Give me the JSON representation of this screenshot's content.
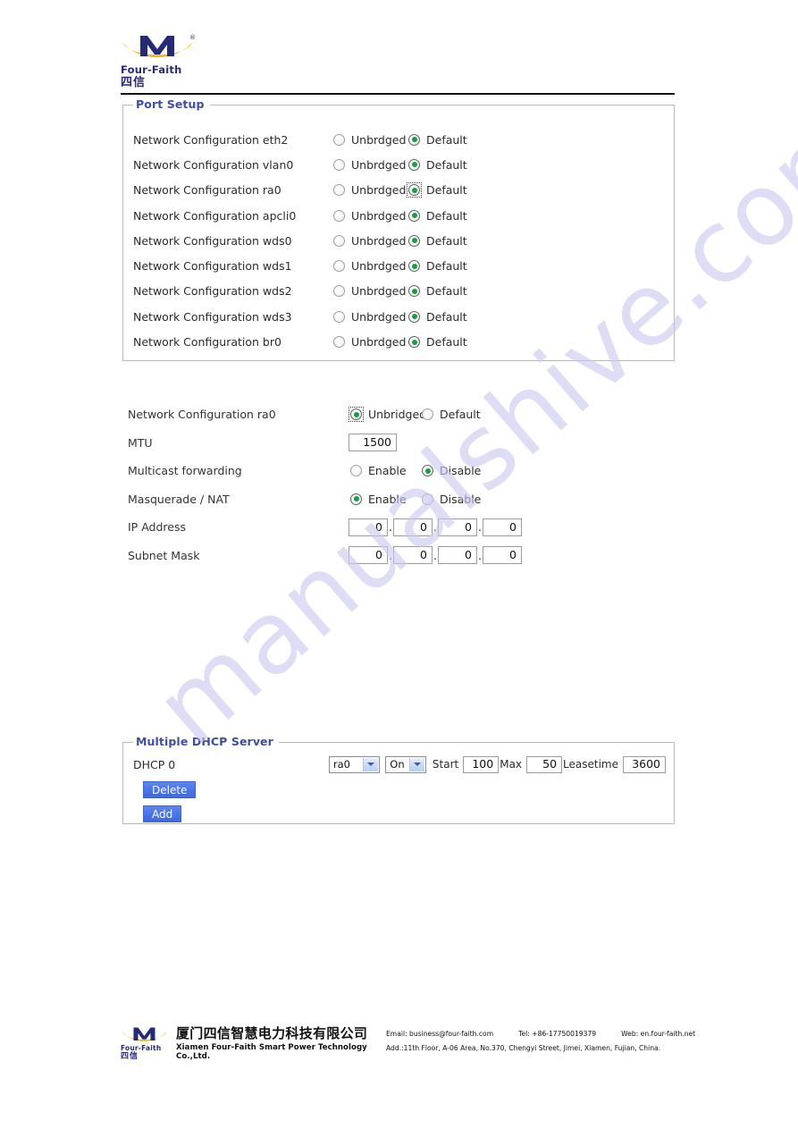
{
  "brand": {
    "name": "Four-Faith",
    "name_cn": "四信",
    "registered_mark": "®"
  },
  "port_setup": {
    "legend": "Port Setup",
    "option_unbridged": "Unbrdged",
    "option_default": "Default",
    "rows": [
      {
        "label": "Network Configuration eth2",
        "selected": "default",
        "focused": false
      },
      {
        "label": "Network Configuration vlan0",
        "selected": "default",
        "focused": false
      },
      {
        "label": "Network Configuration ra0",
        "selected": "default",
        "focused": true
      },
      {
        "label": "Network Configuration apcli0",
        "selected": "default",
        "focused": false
      },
      {
        "label": "Network Configuration wds0",
        "selected": "default",
        "focused": false
      },
      {
        "label": "Network Configuration wds1",
        "selected": "default",
        "focused": false
      },
      {
        "label": "Network Configuration wds2",
        "selected": "default",
        "focused": false
      },
      {
        "label": "Network Configuration wds3",
        "selected": "default",
        "focused": false
      },
      {
        "label": "Network Configuration br0",
        "selected": "default",
        "focused": false
      }
    ]
  },
  "detail": {
    "interface_row": {
      "label": "Network Configuration ra0",
      "option_unbridged": "Unbridged",
      "option_default": "Default",
      "selected": "unbridged"
    },
    "mtu": {
      "label": "MTU",
      "value": "1500"
    },
    "multicast": {
      "label": "Multicast forwarding",
      "option_enable": "Enable",
      "option_disable": "Disable",
      "selected": "disable"
    },
    "masquerade": {
      "label": "Masquerade / NAT",
      "option_enable": "Enable",
      "option_disable": "Disable",
      "selected": "enable"
    },
    "ip_address": {
      "label": "IP Address",
      "octets": [
        "0",
        "0",
        "0",
        "0"
      ]
    },
    "subnet_mask": {
      "label": "Subnet Mask",
      "octets": [
        "0",
        "0",
        "0",
        "0"
      ]
    }
  },
  "dhcp": {
    "legend": "Multiple DHCP Server",
    "row_label": "DHCP 0",
    "interface_value": "ra0",
    "state_value": "On",
    "start_label": "Start",
    "start_value": "100",
    "max_label": "Max",
    "max_value": "50",
    "leasetime_label": "Leasetime",
    "leasetime_value": "3600",
    "delete_label": "Delete",
    "add_label": "Add"
  },
  "watermark": {
    "text": "manualshive.com"
  },
  "footer": {
    "company_cn": "厦门四信智慧电力科技有限公司",
    "company_en": "Xiamen Four-Faith Smart Power Technology Co.,Ltd.",
    "email": "Email: business@four-faith.com",
    "tel": "Tel: +86-17750019379",
    "web": "Web: en.four-faith.net",
    "address": "Add.:11th Floor, A-06 Area, No.370, Chengyi Street, Jimei, Xiamen, Fujian, China."
  }
}
